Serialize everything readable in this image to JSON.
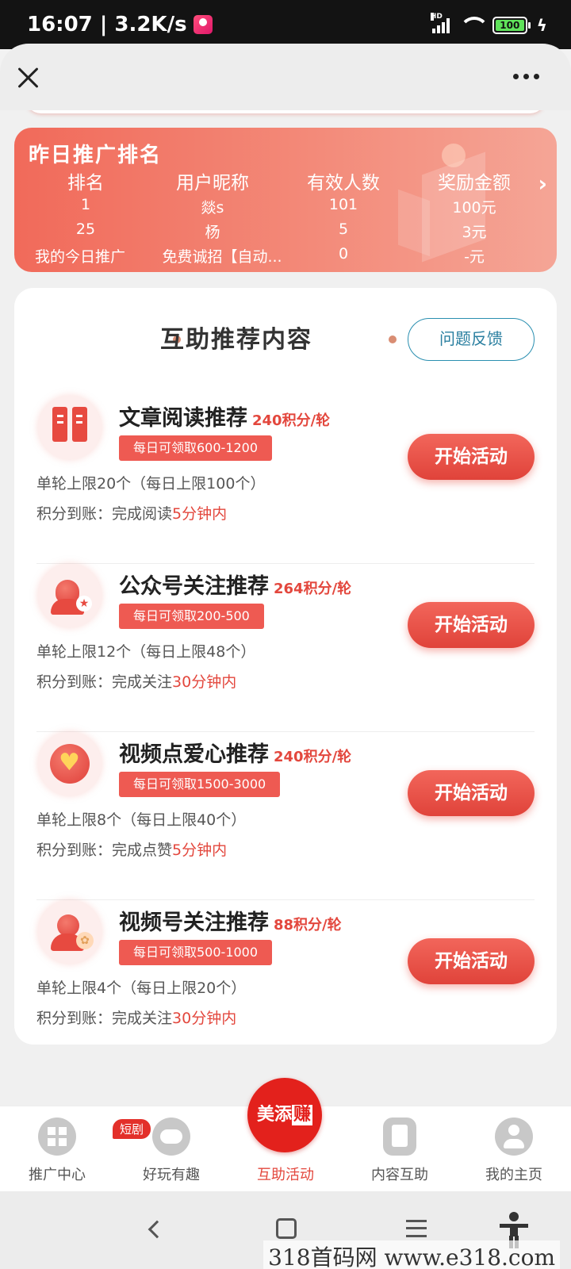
{
  "status_bar": {
    "time_speed": "16:07 | 3.2K/s",
    "network": "HD",
    "battery": "100"
  },
  "ranking": {
    "title": "昨日推广排名",
    "headers": [
      "排名",
      "用户昵称",
      "有效人数",
      "奖励金额"
    ],
    "rows": [
      [
        "1",
        "燚s",
        "101",
        "100元"
      ],
      [
        "25",
        "杨",
        "5",
        "3元"
      ]
    ],
    "mine": [
      "我的今日推广",
      "免费诚招【自动...",
      "0",
      "-元"
    ]
  },
  "section": {
    "title": "互助推荐内容",
    "feedback_label": "问题反馈"
  },
  "items": [
    {
      "icon": "book-icon",
      "title": "文章阅读推荐",
      "points": "240积分/轮",
      "daily": "每日可领取600-1200",
      "limit": "单轮上限20个（每日上限100个）",
      "arrive_prefix": "积分到账：完成阅读",
      "arrive_time": "5分钟内",
      "button": "开始活动"
    },
    {
      "icon": "user-star-icon",
      "title": "公众号关注推荐",
      "points": "264积分/轮",
      "daily": "每日可领取200-500",
      "limit": "单轮上限12个（每日上限48个）",
      "arrive_prefix": "积分到账：完成关注",
      "arrive_time": "30分钟内",
      "button": "开始活动"
    },
    {
      "icon": "heart-icon",
      "title": "视频点爱心推荐",
      "points": "240积分/轮",
      "daily": "每日可领取1500-3000",
      "limit": "单轮上限8个（每日上限40个）",
      "arrive_prefix": "积分到账：完成点赞",
      "arrive_time": "5分钟内",
      "button": "开始活动"
    },
    {
      "icon": "user-add-icon",
      "title": "视频号关注推荐",
      "points": "88积分/轮",
      "daily": "每日可领取500-1000",
      "limit": "单轮上限4个（每日上限20个）",
      "arrive_prefix": "积分到账：完成关注",
      "arrive_time": "30分钟内",
      "button": "开始活动"
    }
  ],
  "tabs": [
    {
      "label": "推广中心",
      "icon": "grid-icon"
    },
    {
      "label": "好玩有趣",
      "icon": "gamepad-icon",
      "badge": "短剧"
    },
    {
      "label": "互助活动",
      "icon": "app-logo-icon",
      "active": true,
      "logo_text_a": "美添",
      "logo_text_b": "赚"
    },
    {
      "label": "内容互助",
      "icon": "document-icon"
    },
    {
      "label": "我的主页",
      "icon": "person-icon"
    }
  ],
  "watermark": "318首码网 www.e318.com",
  "colors": {
    "accent": "#e3473d",
    "banner": "#f16a5a",
    "feedback": "#2a8fb0"
  }
}
